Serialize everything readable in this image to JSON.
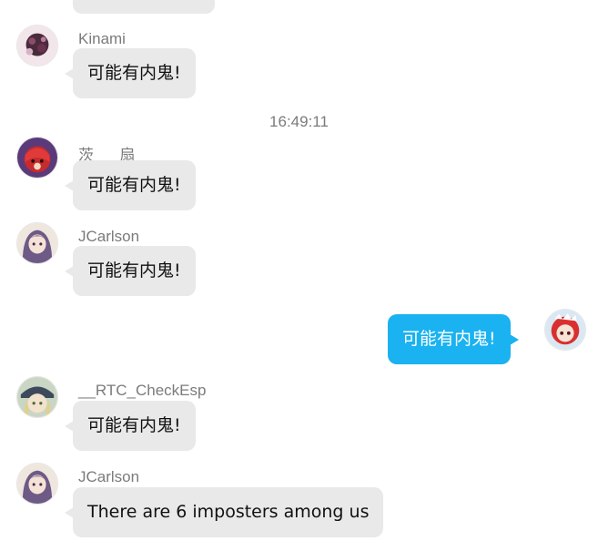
{
  "timestamp": "16:49:11",
  "messages": [
    {
      "sender": "",
      "text": "",
      "avatar": "none",
      "self": false
    },
    {
      "sender": "Kinami",
      "text": "可能有内鬼!",
      "avatar": "dark-flower-avatar",
      "self": false
    },
    {
      "sender": "茨___扇",
      "text": "可能有内鬼!",
      "avatar": "red-hair-anime-avatar",
      "self": false
    },
    {
      "sender": "JCarlson",
      "text": "可能有内鬼!",
      "avatar": "purple-hair-anime-avatar",
      "self": false
    },
    {
      "sender": "",
      "text": "可能有内鬼!",
      "avatar": "red-hair-maid-avatar",
      "self": true
    },
    {
      "sender": "__RTC_CheckEsp",
      "text": "可能有内鬼!",
      "avatar": "blonde-hat-anime-avatar",
      "self": false
    },
    {
      "sender": "JCarlson",
      "text": "There are 6 imposters among us",
      "avatar": "purple-hair-anime-avatar",
      "self": false
    }
  ],
  "colors": {
    "bubble_other": "#e9e9e9",
    "bubble_self": "#1ab2f0",
    "meta_text": "#7b7b7b"
  }
}
